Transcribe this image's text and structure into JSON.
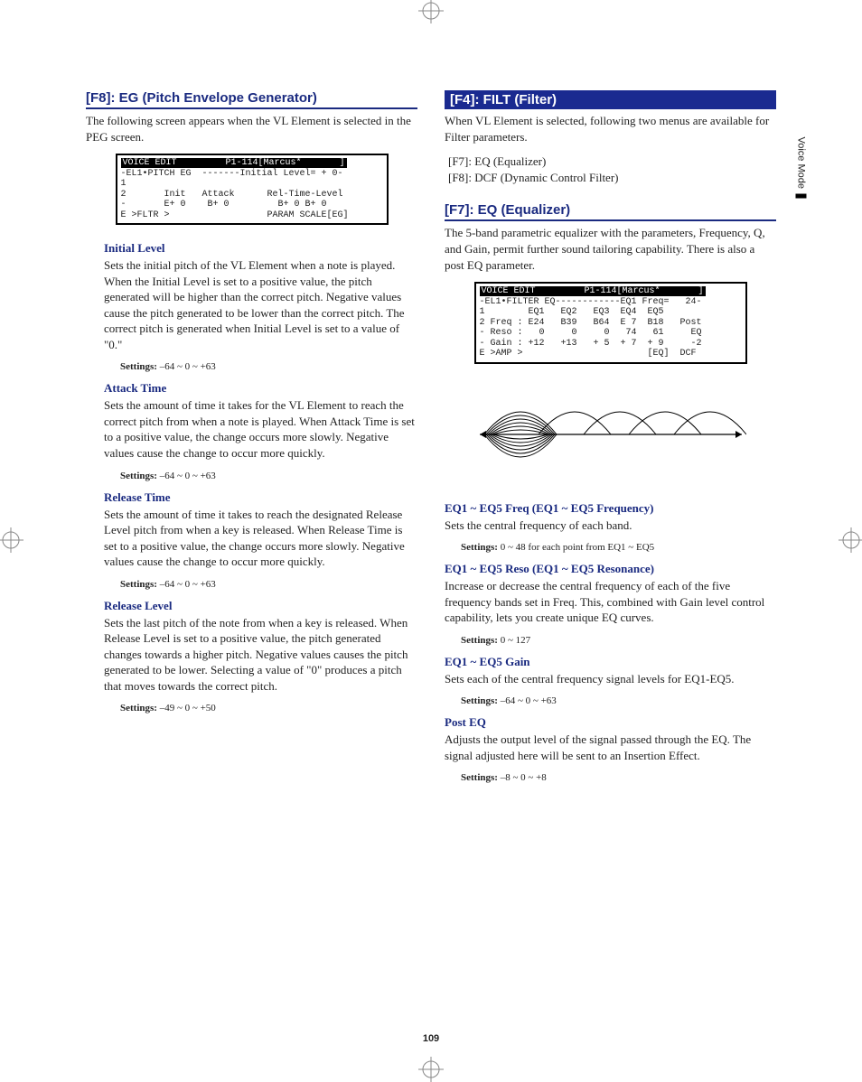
{
  "page_number": "109",
  "side_tab": "Voice Mode",
  "left": {
    "f8_title": "[F8]: EG (Pitch Envelope Generator)",
    "f8_intro": "The following screen appears when the VL Element is selected in the PEG screen.",
    "lcd1_header": "VOICE EDIT         P1-114[Marcus*       ]",
    "lcd1_lines": "-EL1•PITCH EG  -------Initial Level= + 0-\n1\n2       Init   Attack      Rel-Time-Level\n-       E+ 0    B+ 0         B+ 0 B+ 0\nE >FLTR >                  PARAM SCALE[EG]",
    "params": [
      {
        "head": "Initial Level",
        "body": "Sets the initial pitch of the VL Element when a note is played. When the Initial Level is set to a positive value, the pitch generated will be higher than the correct pitch. Negative values cause the pitch generated to be lower than the correct pitch. The correct pitch is generated when Initial Level is set to a value of \"0.\"",
        "settings": "–64 ~ 0 ~ +63"
      },
      {
        "head": "Attack Time",
        "body": "Sets the amount of time it takes for the VL Element to reach the correct pitch from when a note is played. When Attack Time is set to a positive value, the change occurs more slowly. Negative values cause the change to occur more quickly.",
        "settings": "–64 ~ 0 ~ +63"
      },
      {
        "head": "Release Time",
        "body": "Sets the amount of time it takes to reach the designated Release Level pitch from when a key is released. When Release Time is set to a positive value, the change occurs more slowly. Negative values cause the change to occur more quickly.",
        "settings": "–64 ~ 0 ~ +63"
      },
      {
        "head": "Release Level",
        "body": "Sets the last pitch of the note from when a key is released. When Release Level is set to a positive value, the pitch generated changes towards a higher pitch. Negative values causes the pitch generated to be lower. Selecting a value of \"0\" produces a pitch that moves towards the correct pitch.",
        "settings": "–49 ~ 0 ~ +50"
      }
    ]
  },
  "right": {
    "filt_title": "[F4]: FILT (Filter)",
    "filt_intro": "When VL Element is selected, following two menus are available for Filter parameters.",
    "filter_list_1": "[F7]: EQ (Equalizer)",
    "filter_list_2": "[F8]: DCF (Dynamic Control Filter)",
    "f7_title": "[F7]: EQ (Equalizer)",
    "f7_intro": "The 5-band parametric equalizer with the parameters, Frequency, Q, and Gain, permit further sound tailoring capability. There is also a post EQ parameter.",
    "lcd2_header": "VOICE EDIT         P1-114[Marcus*       ]",
    "lcd2_lines": "-EL1•FILTER EQ------------EQ1 Freq=   24-\n1        EQ1   EQ2   EQ3  EQ4  EQ5\n2 Freq : E24   B39   B64  E 7  B18   Post\n- Reso :   0     0     0   74   61     EQ\n- Gain : +12   +13   + 5  + 7  + 9     -2\nE >AMP >                       [EQ]  DCF",
    "params": [
      {
        "head": "EQ1 ~ EQ5 Freq (EQ1 ~ EQ5 Frequency)",
        "body": "Sets the central frequency of each band.",
        "settings": "0 ~ 48 for each point from EQ1 ~ EQ5"
      },
      {
        "head": "EQ1 ~ EQ5 Reso (EQ1 ~ EQ5 Resonance)",
        "body": "Increase or decrease the central frequency of each of the five frequency bands set in Freq. This, combined with Gain level control capability, lets you create unique EQ curves.",
        "settings": "0 ~ 127"
      },
      {
        "head": "EQ1 ~ EQ5 Gain",
        "body": "Sets each of the central frequency signal levels for EQ1-EQ5.",
        "settings": "–64 ~ 0 ~ +63"
      },
      {
        "head": "Post EQ",
        "body": "Adjusts the output level of the signal passed through the EQ. The signal adjusted here will be sent to an Insertion Effect.",
        "settings": "–8 ~ 0 ~ +8"
      }
    ]
  }
}
